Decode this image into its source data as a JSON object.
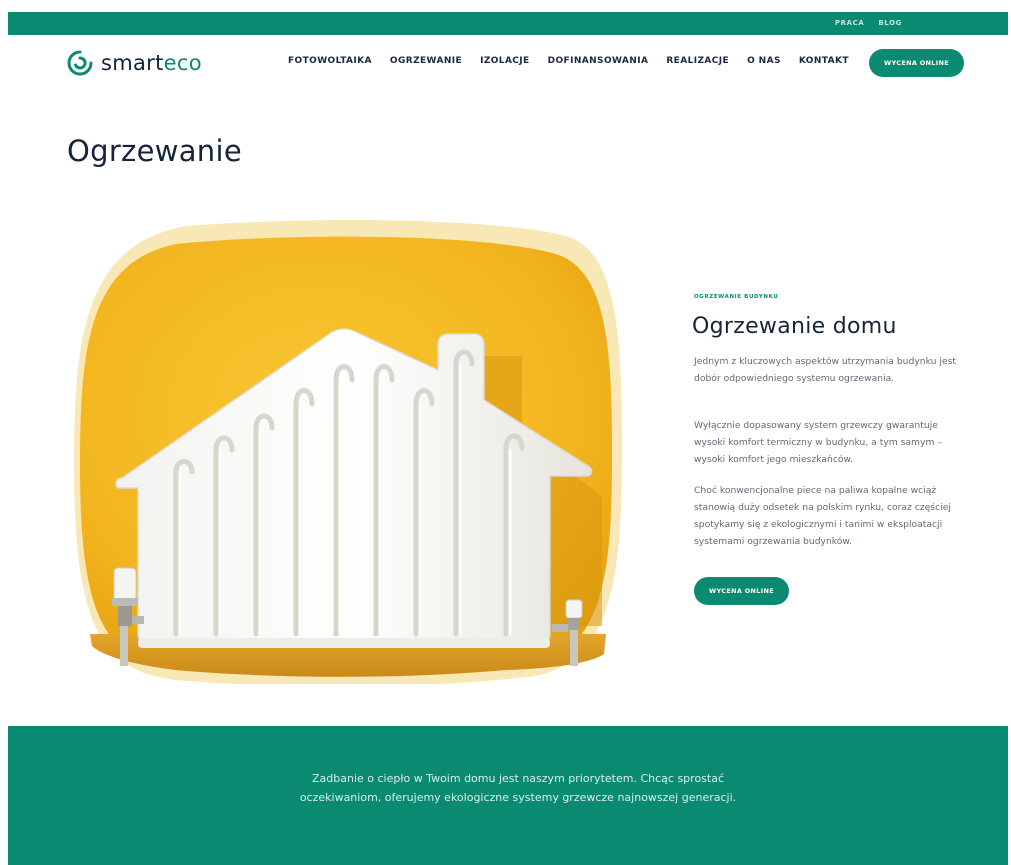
{
  "topbar": {
    "links": [
      "PRACA",
      "BLOG"
    ]
  },
  "header": {
    "logo_text": "smart",
    "logo_text_accent": "eco",
    "nav": [
      "FOTOWOLTAIKA",
      "OGRZEWANIE",
      "IZOLACJE",
      "DOFINANSOWANIA",
      "REALIZACJE",
      "O NAS",
      "KONTAKT"
    ],
    "cta_label": "WYCENA ONLINE"
  },
  "page": {
    "title": "Ogrzewanie"
  },
  "section": {
    "eyebrow": "OGRZEWANIE BUDYNKU",
    "title": "Ogrzewanie domu",
    "paragraphs": [
      "Jednym z kluczowych aspektów utrzymania budynku jest dobór odpowiedniego systemu ogrzewania.",
      "Wyłącznie dopasowany system grzewczy gwarantuje wysoki komfort termiczny w budynku, a tym samym – wysoki komfort jego mieszkańców.",
      "Choć konwencjonalne piece na paliwa kopalne wciąż stanowią duży odsetek na polskim rynku, coraz częściej spotykamy się z ekologicznymi i tanimi w eksploatacji systemami ogrzewania budynków."
    ],
    "cta_label": "WYCENA ONLINE"
  },
  "band": {
    "text": "Zadbanie o ciepło w Twoim domu jest naszym priorytetem. Chcąc sprostać oczekiwaniom, oferujemy ekologiczne systemy grzewcze najnowszej generacji."
  },
  "colors": {
    "brand": "#0a8a70",
    "heading": "#14253b",
    "body_text": "#5f6b78",
    "hero_yellow": "#f2b51f"
  },
  "icons": [
    "smarteco-logo-icon",
    "house-radiator-image"
  ]
}
